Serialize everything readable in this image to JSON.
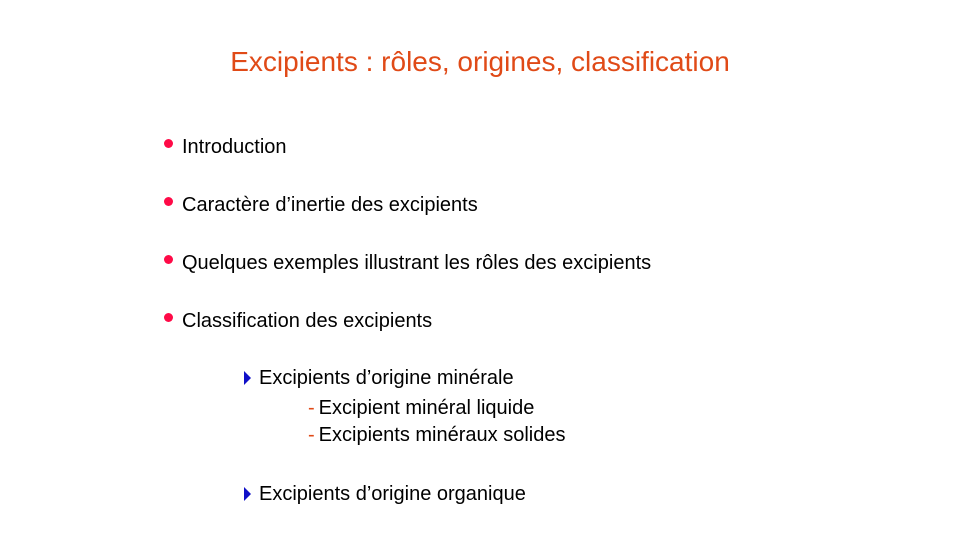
{
  "title": "Excipients : rôles, origines, classification",
  "items": [
    {
      "label": "Introduction"
    },
    {
      "label": "Caractère d’inertie des excipients"
    },
    {
      "label": "Quelques exemples illustrant les rôles des excipients"
    },
    {
      "label": "Classification des excipients"
    }
  ],
  "subitems": [
    {
      "label": "Excipients d’origine minérale"
    },
    {
      "label": "Excipients d’origine organique"
    }
  ],
  "subsubitems": [
    {
      "dash": "-",
      "label": "Excipient minéral liquide"
    },
    {
      "dash": "-",
      "label": "Excipients minéraux solides"
    }
  ],
  "colors": {
    "title": "#e04a17",
    "bullet": "#ff0a47",
    "arrow": "#1010c8",
    "dash": "#e04a17"
  }
}
